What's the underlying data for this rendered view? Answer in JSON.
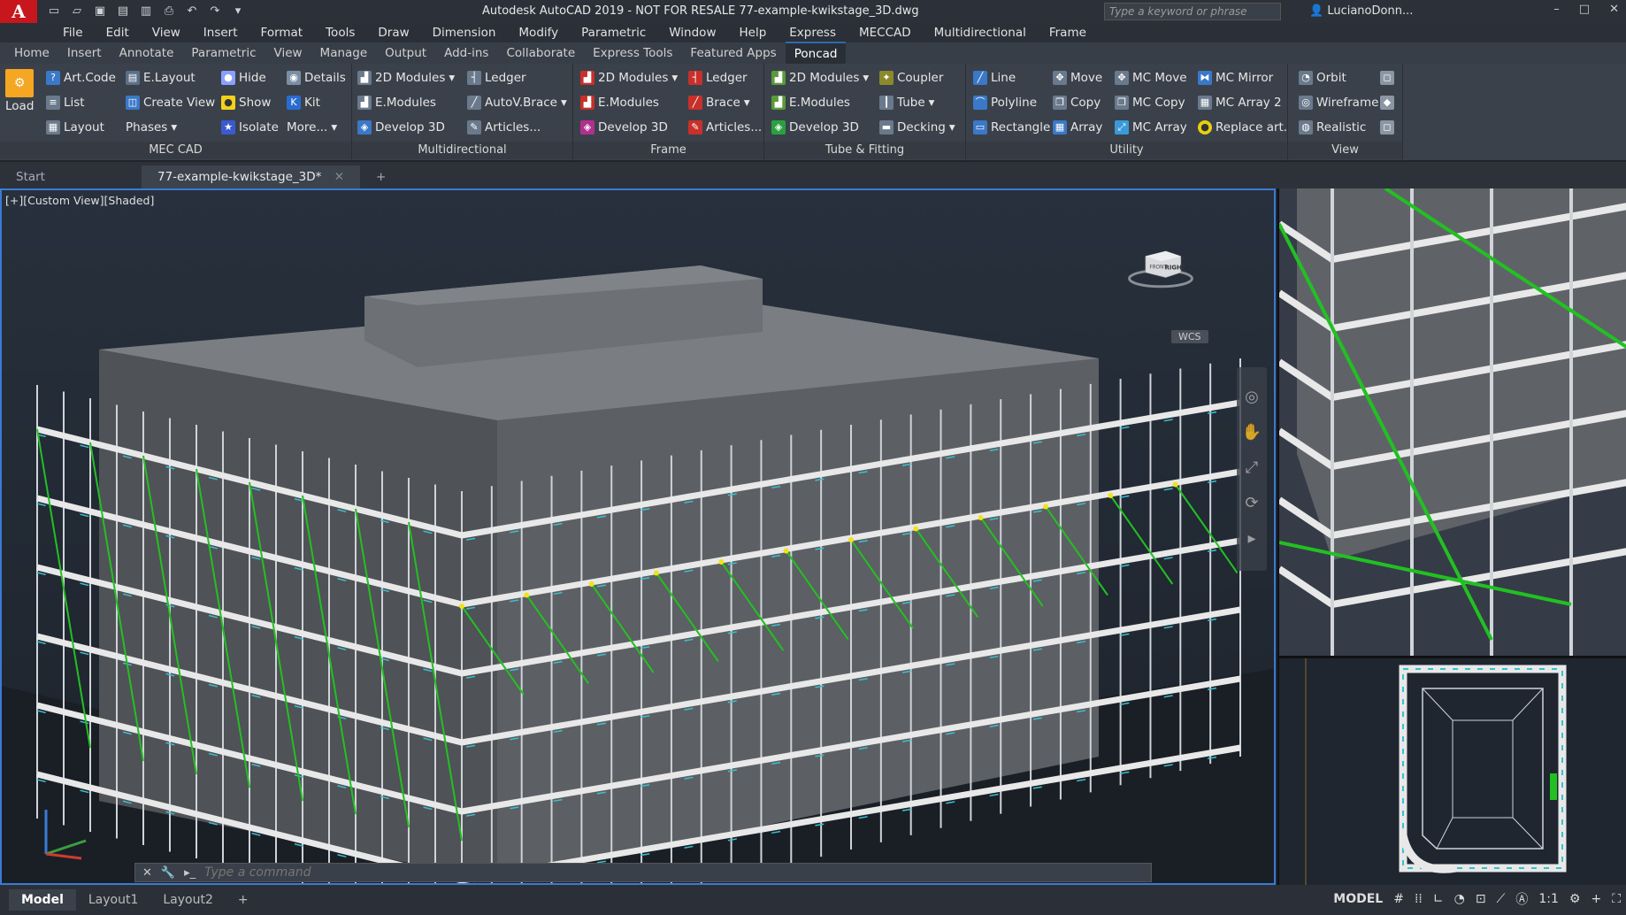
{
  "app": {
    "logo": "A",
    "title": "Autodesk AutoCAD 2019 - NOT FOR RESALE    77-example-kwikstage_3D.dwg",
    "search_placeholder": "Type a keyword or phrase",
    "user": "LucianoDonn..."
  },
  "menu": [
    "File",
    "Edit",
    "View",
    "Insert",
    "Format",
    "Tools",
    "Draw",
    "Dimension",
    "Modify",
    "Parametric",
    "Window",
    "Help",
    "Express",
    "MECCAD",
    "Multidirectional",
    "Frame"
  ],
  "tabs": [
    "Home",
    "Insert",
    "Annotate",
    "Parametric",
    "View",
    "Manage",
    "Output",
    "Add-ins",
    "Collaborate",
    "Express Tools",
    "Featured Apps",
    "Poncad"
  ],
  "active_tab": "Poncad",
  "ribbon": {
    "meccad": {
      "title": "MEC CAD",
      "load": "Load",
      "buttons": [
        "Art.Code",
        "E.Layout",
        "Hide",
        "Details",
        "List",
        "Create View",
        "Show",
        "Kit",
        "Layout",
        "Phases",
        "Isolate",
        "More..."
      ]
    },
    "multidirectional": {
      "title": "Multidirectional",
      "buttons": [
        "2D Modules",
        "Ledger",
        "E.Modules",
        "AutoV.Brace",
        "Develop 3D",
        "Articles..."
      ]
    },
    "frame": {
      "title": "Frame",
      "buttons": [
        "2D Modules",
        "Ledger",
        "E.Modules",
        "Brace",
        "Develop 3D",
        "Articles..."
      ]
    },
    "tube": {
      "title": "Tube & Fitting",
      "buttons": [
        "2D Modules",
        "Coupler",
        "E.Modules",
        "Tube",
        "Develop 3D",
        "Decking"
      ]
    },
    "utility": {
      "title": "Utility",
      "buttons": [
        "Line",
        "Move",
        "MC Move",
        "MC Mirror",
        "Polyline",
        "Copy",
        "MC Copy",
        "MC Array 2",
        "Rectangle",
        "Array",
        "MC Array",
        "Replace art."
      ]
    },
    "view": {
      "title": "View",
      "buttons": [
        "Orbit",
        "Wireframe",
        "Realistic"
      ]
    }
  },
  "doc_tabs": [
    "Start",
    "77-example-kwikstage_3D*"
  ],
  "viewport": {
    "label": "[+][Custom View][Shaded]",
    "cube_front": "FRONT",
    "cube_right": "RIGHT",
    "wcs": "WCS"
  },
  "command": {
    "placeholder": "Type a command"
  },
  "status": {
    "layouts": [
      "Model",
      "Layout1",
      "Layout2"
    ],
    "mode": "MODEL",
    "scale": "1:1"
  },
  "colors": {
    "accent": "#3a7bd5",
    "brace": "#22c022",
    "ledger": "#e8e8e8",
    "node": "#f2e21a"
  }
}
